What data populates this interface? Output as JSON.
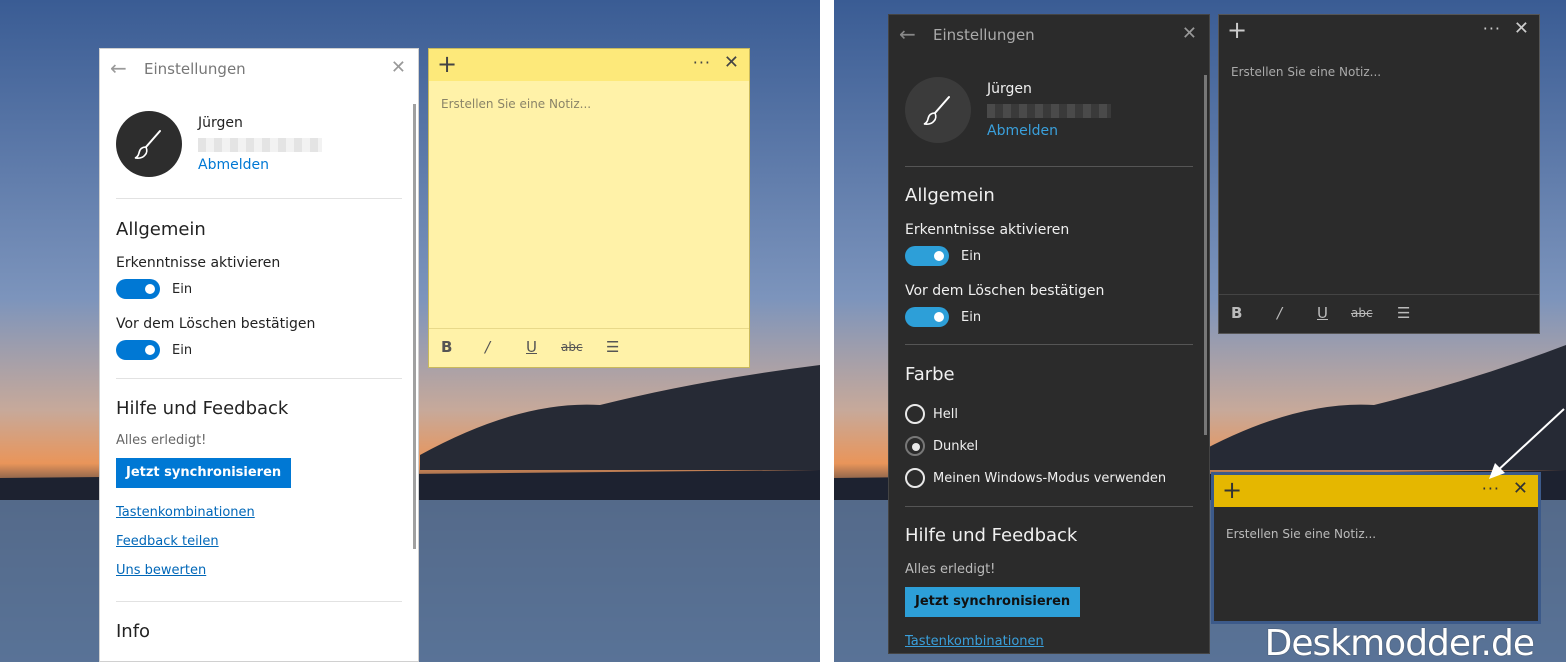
{
  "colors": {
    "accent": "#0078d4",
    "accent_dark": "#2d9fd8",
    "note_yellow": "#fff2a8",
    "note_yellow_bar": "#fde97a",
    "note_yellow_dark": "#e5b700",
    "dark_bg": "#2b2b2b"
  },
  "left": {
    "settings": {
      "title": "Einstellungen",
      "user_name": "Jürgen",
      "sign_out": "Abmelden",
      "section_general": "Allgemein",
      "insights_label": "Erkenntnisse aktivieren",
      "insights_state": "Ein",
      "confirm_delete_label": "Vor dem Löschen bestätigen",
      "confirm_delete_state": "Ein",
      "section_help": "Hilfe und Feedback",
      "sync_status": "Alles erledigt!",
      "sync_button": "Jetzt synchronisieren",
      "link_shortcuts": "Tastenkombinationen",
      "link_feedback": "Feedback teilen",
      "link_rate": "Uns bewerten",
      "section_info": "Info"
    },
    "note": {
      "placeholder": "Erstellen Sie eine Notiz...",
      "format": {
        "bold": "B",
        "italic": "/",
        "underline": "U",
        "strike": "abc"
      }
    }
  },
  "right": {
    "settings": {
      "title": "Einstellungen",
      "user_name": "Jürgen",
      "sign_out": "Abmelden",
      "section_general": "Allgemein",
      "insights_label": "Erkenntnisse aktivieren",
      "insights_state": "Ein",
      "confirm_delete_label": "Vor dem Löschen bestätigen",
      "confirm_delete_state": "Ein",
      "section_color": "Farbe",
      "radio_light": "Hell",
      "radio_dark": "Dunkel",
      "radio_windows": "Meinen Windows-Modus verwenden",
      "section_help": "Hilfe und Feedback",
      "sync_status": "Alles erledigt!",
      "sync_button": "Jetzt synchronisieren",
      "link_shortcuts": "Tastenkombinationen"
    },
    "note_dark": {
      "placeholder": "Erstellen Sie eine Notiz...",
      "format": {
        "bold": "B",
        "italic": "/",
        "underline": "U",
        "strike": "abc"
      }
    },
    "note_small": {
      "placeholder": "Erstellen Sie eine Notiz..."
    },
    "watermark": "Deskmodder.de"
  }
}
